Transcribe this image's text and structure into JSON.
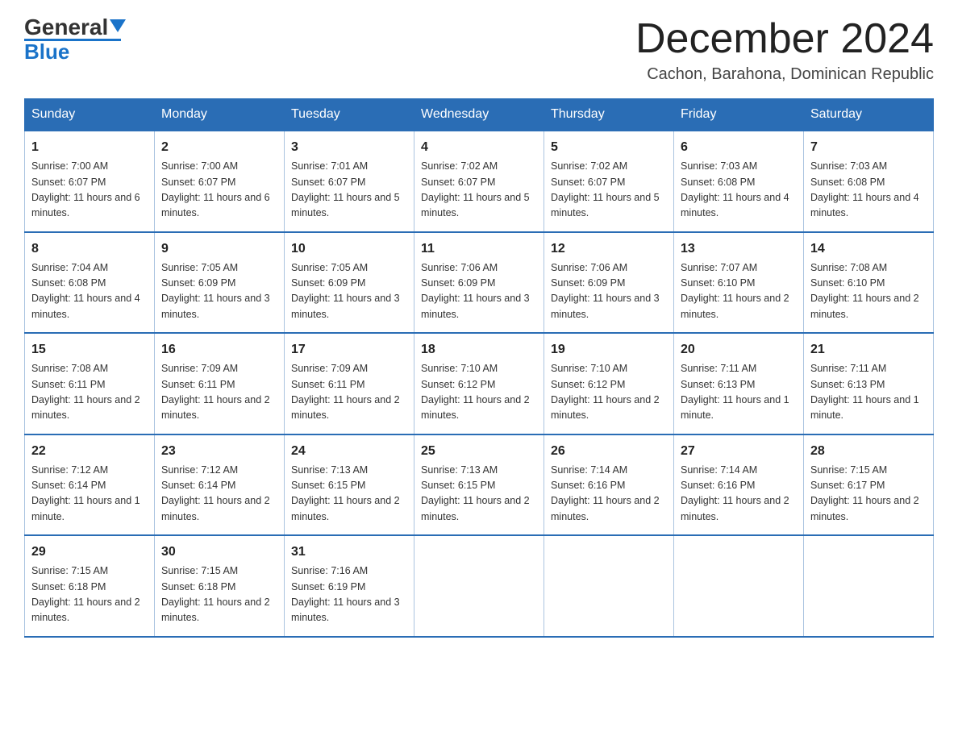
{
  "header": {
    "logo_text_black": "General",
    "logo_text_blue": "Blue",
    "month_title": "December 2024",
    "location": "Cachon, Barahona, Dominican Republic"
  },
  "days_of_week": [
    "Sunday",
    "Monday",
    "Tuesday",
    "Wednesday",
    "Thursday",
    "Friday",
    "Saturday"
  ],
  "weeks": [
    [
      {
        "day": "1",
        "sunrise": "7:00 AM",
        "sunset": "6:07 PM",
        "daylight": "11 hours and 6 minutes."
      },
      {
        "day": "2",
        "sunrise": "7:00 AM",
        "sunset": "6:07 PM",
        "daylight": "11 hours and 6 minutes."
      },
      {
        "day": "3",
        "sunrise": "7:01 AM",
        "sunset": "6:07 PM",
        "daylight": "11 hours and 5 minutes."
      },
      {
        "day": "4",
        "sunrise": "7:02 AM",
        "sunset": "6:07 PM",
        "daylight": "11 hours and 5 minutes."
      },
      {
        "day": "5",
        "sunrise": "7:02 AM",
        "sunset": "6:07 PM",
        "daylight": "11 hours and 5 minutes."
      },
      {
        "day": "6",
        "sunrise": "7:03 AM",
        "sunset": "6:08 PM",
        "daylight": "11 hours and 4 minutes."
      },
      {
        "day": "7",
        "sunrise": "7:03 AM",
        "sunset": "6:08 PM",
        "daylight": "11 hours and 4 minutes."
      }
    ],
    [
      {
        "day": "8",
        "sunrise": "7:04 AM",
        "sunset": "6:08 PM",
        "daylight": "11 hours and 4 minutes."
      },
      {
        "day": "9",
        "sunrise": "7:05 AM",
        "sunset": "6:09 PM",
        "daylight": "11 hours and 3 minutes."
      },
      {
        "day": "10",
        "sunrise": "7:05 AM",
        "sunset": "6:09 PM",
        "daylight": "11 hours and 3 minutes."
      },
      {
        "day": "11",
        "sunrise": "7:06 AM",
        "sunset": "6:09 PM",
        "daylight": "11 hours and 3 minutes."
      },
      {
        "day": "12",
        "sunrise": "7:06 AM",
        "sunset": "6:09 PM",
        "daylight": "11 hours and 3 minutes."
      },
      {
        "day": "13",
        "sunrise": "7:07 AM",
        "sunset": "6:10 PM",
        "daylight": "11 hours and 2 minutes."
      },
      {
        "day": "14",
        "sunrise": "7:08 AM",
        "sunset": "6:10 PM",
        "daylight": "11 hours and 2 minutes."
      }
    ],
    [
      {
        "day": "15",
        "sunrise": "7:08 AM",
        "sunset": "6:11 PM",
        "daylight": "11 hours and 2 minutes."
      },
      {
        "day": "16",
        "sunrise": "7:09 AM",
        "sunset": "6:11 PM",
        "daylight": "11 hours and 2 minutes."
      },
      {
        "day": "17",
        "sunrise": "7:09 AM",
        "sunset": "6:11 PM",
        "daylight": "11 hours and 2 minutes."
      },
      {
        "day": "18",
        "sunrise": "7:10 AM",
        "sunset": "6:12 PM",
        "daylight": "11 hours and 2 minutes."
      },
      {
        "day": "19",
        "sunrise": "7:10 AM",
        "sunset": "6:12 PM",
        "daylight": "11 hours and 2 minutes."
      },
      {
        "day": "20",
        "sunrise": "7:11 AM",
        "sunset": "6:13 PM",
        "daylight": "11 hours and 1 minute."
      },
      {
        "day": "21",
        "sunrise": "7:11 AM",
        "sunset": "6:13 PM",
        "daylight": "11 hours and 1 minute."
      }
    ],
    [
      {
        "day": "22",
        "sunrise": "7:12 AM",
        "sunset": "6:14 PM",
        "daylight": "11 hours and 1 minute."
      },
      {
        "day": "23",
        "sunrise": "7:12 AM",
        "sunset": "6:14 PM",
        "daylight": "11 hours and 2 minutes."
      },
      {
        "day": "24",
        "sunrise": "7:13 AM",
        "sunset": "6:15 PM",
        "daylight": "11 hours and 2 minutes."
      },
      {
        "day": "25",
        "sunrise": "7:13 AM",
        "sunset": "6:15 PM",
        "daylight": "11 hours and 2 minutes."
      },
      {
        "day": "26",
        "sunrise": "7:14 AM",
        "sunset": "6:16 PM",
        "daylight": "11 hours and 2 minutes."
      },
      {
        "day": "27",
        "sunrise": "7:14 AM",
        "sunset": "6:16 PM",
        "daylight": "11 hours and 2 minutes."
      },
      {
        "day": "28",
        "sunrise": "7:15 AM",
        "sunset": "6:17 PM",
        "daylight": "11 hours and 2 minutes."
      }
    ],
    [
      {
        "day": "29",
        "sunrise": "7:15 AM",
        "sunset": "6:18 PM",
        "daylight": "11 hours and 2 minutes."
      },
      {
        "day": "30",
        "sunrise": "7:15 AM",
        "sunset": "6:18 PM",
        "daylight": "11 hours and 2 minutes."
      },
      {
        "day": "31",
        "sunrise": "7:16 AM",
        "sunset": "6:19 PM",
        "daylight": "11 hours and 3 minutes."
      },
      null,
      null,
      null,
      null
    ]
  ]
}
